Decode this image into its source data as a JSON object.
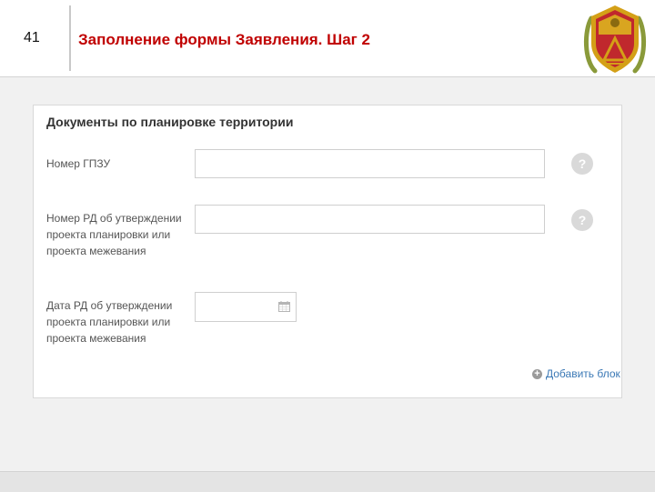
{
  "slide": {
    "number": "41",
    "title": "Заполнение формы Заявления. Шаг 2"
  },
  "form": {
    "section_title": "Документы по планировке территории",
    "fields": [
      {
        "label": "Номер ГПЗУ",
        "value": "",
        "placeholder": ""
      },
      {
        "label": "Номер РД об утверждении проекта планировки или проекта межевания",
        "value": "",
        "placeholder": ""
      },
      {
        "label": "Дата РД об утверждении проекта планировки или проекта межевания",
        "value": "",
        "placeholder": ""
      }
    ],
    "help_symbol": "?",
    "add_block_label": "Добавить блок"
  },
  "icons": {
    "help": "question-circle-icon",
    "calendar": "calendar-icon",
    "add": "plus-circle-icon",
    "emblem": "coat-of-arms-emblem"
  },
  "colors": {
    "title": "#c00000",
    "link": "#3a78b5",
    "background": "#f1f1f1",
    "emblem_red": "#c0282d",
    "emblem_gold": "#d4a017"
  }
}
